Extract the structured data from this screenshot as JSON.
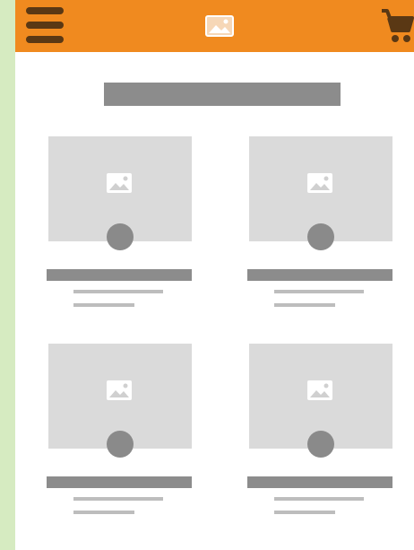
{
  "app": {
    "header": {
      "menu_icon": "hamburger-menu-icon",
      "logo_icon": "image-placeholder-icon",
      "cart_icon": "shopping-cart-icon",
      "accent_color": "#f08a1f",
      "icon_color": "#5a3814"
    },
    "content": {
      "title_placeholder_color": "#8c8c8c",
      "products": [
        {
          "image_icon": "image-placeholder-icon"
        },
        {
          "image_icon": "image-placeholder-icon"
        },
        {
          "image_icon": "image-placeholder-icon"
        },
        {
          "image_icon": "image-placeholder-icon"
        }
      ]
    }
  }
}
